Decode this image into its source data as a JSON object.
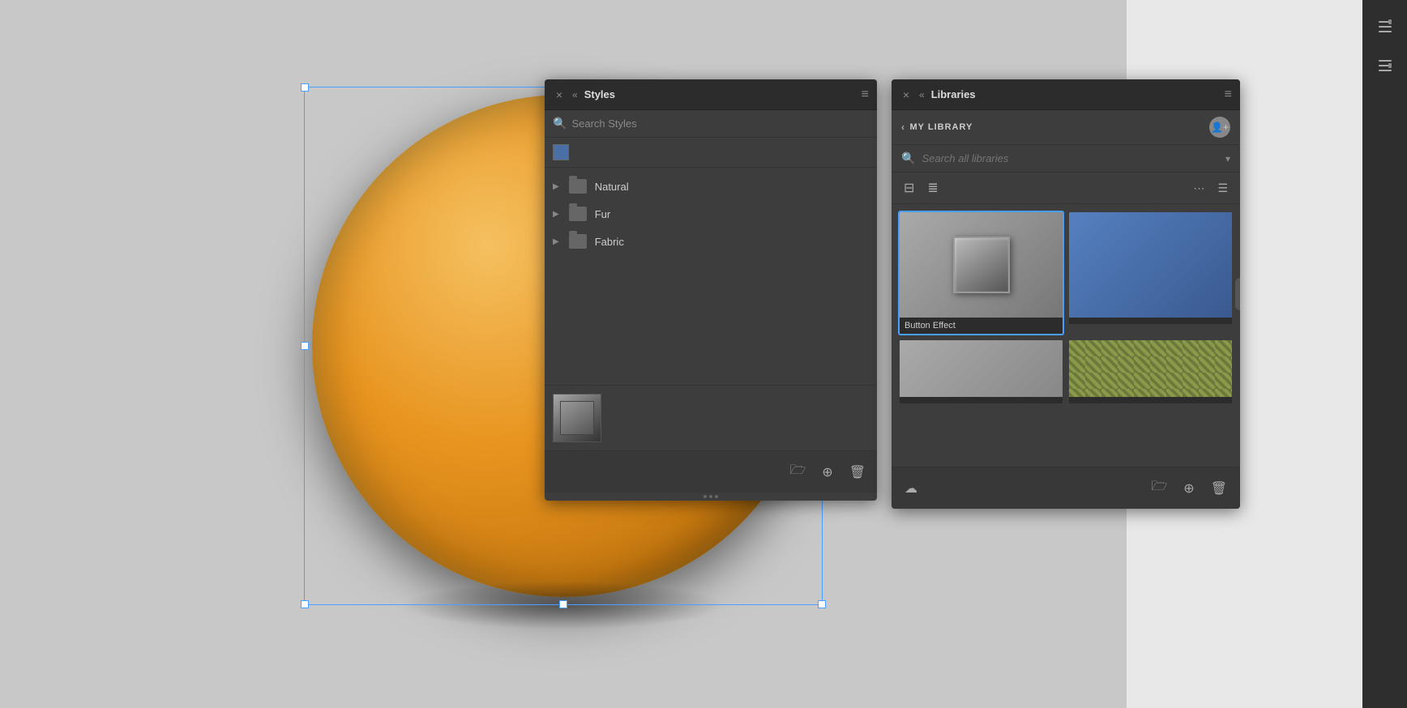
{
  "canvas": {
    "background": "#cccccc"
  },
  "styles_panel": {
    "title": "Styles",
    "search_placeholder": "Search Styles",
    "close_btn": "×",
    "collapse_btn": "«",
    "menu_btn": "≡",
    "items": [
      {
        "label": "Natural"
      },
      {
        "label": "Fur"
      },
      {
        "label": "Fabric"
      }
    ],
    "footer": {
      "folder_btn": "🗁",
      "add_btn": "+",
      "delete_btn": "🗑"
    }
  },
  "libraries_panel": {
    "title": "Libraries",
    "close_btn": "×",
    "collapse_btn": "«",
    "menu_btn": "≡",
    "my_library_label": "MY LIBRARY",
    "search_placeholder": "Search all libraries",
    "grid_items": [
      {
        "label": "Button Effect",
        "type": "button-effect",
        "selected": true
      },
      {
        "label": "",
        "type": "blue",
        "selected": false
      },
      {
        "label": "",
        "type": "gray2",
        "selected": false
      },
      {
        "label": "",
        "type": "pattern",
        "selected": false
      }
    ],
    "footer": {
      "cloud_btn": "☁",
      "folder_btn": "🗁",
      "add_btn": "+",
      "delete_btn": "🗑"
    }
  },
  "toolbar": {
    "icon1": "≡",
    "icon2": "≡"
  }
}
